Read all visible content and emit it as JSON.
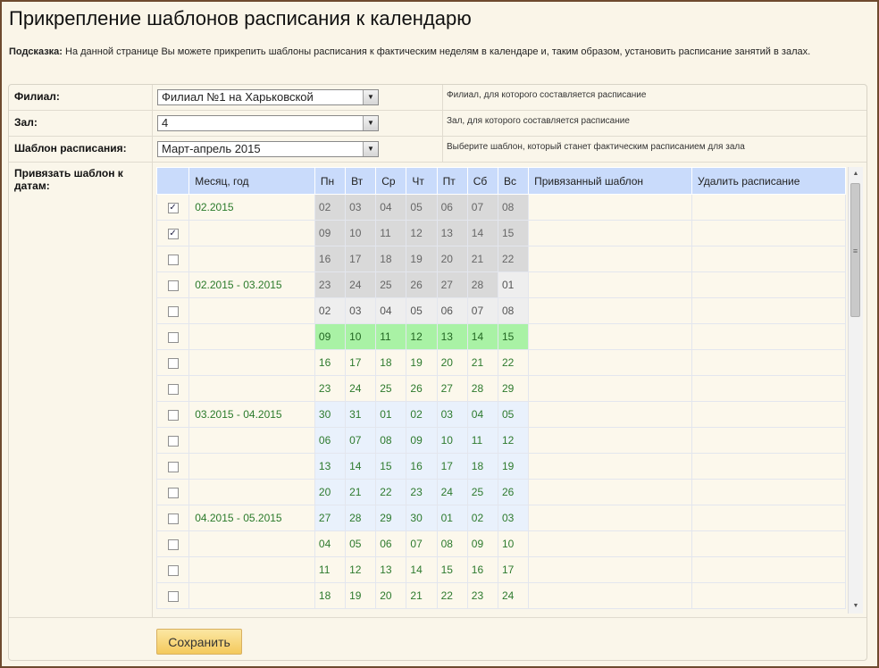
{
  "page": {
    "title": "Прикрепление шаблонов расписания к календарю",
    "hint_label": "Подсказка:",
    "hint_text": " На данной странице Вы можете прикрепить шаблоны расписания к фактическим неделям в календаре и, таким образом, установить расписание занятий в залах."
  },
  "form": {
    "branch": {
      "label": "Филиал:",
      "value": "Филиал №1 на Харьковской",
      "description": "Филиал, для которого составляется расписание"
    },
    "hall": {
      "label": "Зал:",
      "value": "4",
      "description": "Зал, для которого составляется расписание"
    },
    "template": {
      "label": "Шаблон расписания:",
      "value": "Март-апрель 2015",
      "description": "Выберите шаблон, который станет фактическим расписанием для зала"
    },
    "bind_label": "Привязать шаблон к датам:"
  },
  "grid": {
    "headers": [
      "",
      "Месяц, год",
      "Пн",
      "Вт",
      "Ср",
      "Чт",
      "Пт",
      "Сб",
      "Вс",
      "Привязанный шаблон",
      "Удалить расписание"
    ],
    "rows": [
      {
        "checked": true,
        "month": "02.2015",
        "days": [
          "02",
          "03",
          "04",
          "05",
          "06",
          "07",
          "08"
        ],
        "style": "past"
      },
      {
        "checked": true,
        "month": "",
        "days": [
          "09",
          "10",
          "11",
          "12",
          "13",
          "14",
          "15"
        ],
        "style": "past"
      },
      {
        "checked": false,
        "month": "",
        "days": [
          "16",
          "17",
          "18",
          "19",
          "20",
          "21",
          "22"
        ],
        "style": "past"
      },
      {
        "checked": false,
        "month": "02.2015 - 03.2015",
        "days": [
          "23",
          "24",
          "25",
          "26",
          "27",
          "28",
          "01"
        ],
        "style": "past-mixed"
      },
      {
        "checked": false,
        "month": "",
        "days": [
          "02",
          "03",
          "04",
          "05",
          "06",
          "07",
          "08"
        ],
        "style": "gray"
      },
      {
        "checked": false,
        "month": "",
        "days": [
          "09",
          "10",
          "11",
          "12",
          "13",
          "14",
          "15"
        ],
        "style": "current"
      },
      {
        "checked": false,
        "month": "",
        "days": [
          "16",
          "17",
          "18",
          "19",
          "20",
          "21",
          "22"
        ],
        "style": "plain"
      },
      {
        "checked": false,
        "month": "",
        "days": [
          "23",
          "24",
          "25",
          "26",
          "27",
          "28",
          "29"
        ],
        "style": "plain"
      },
      {
        "checked": false,
        "month": "03.2015 - 04.2015",
        "days": [
          "30",
          "31",
          "01",
          "02",
          "03",
          "04",
          "05"
        ],
        "style": "blue"
      },
      {
        "checked": false,
        "month": "",
        "days": [
          "06",
          "07",
          "08",
          "09",
          "10",
          "11",
          "12"
        ],
        "style": "blue"
      },
      {
        "checked": false,
        "month": "",
        "days": [
          "13",
          "14",
          "15",
          "16",
          "17",
          "18",
          "19"
        ],
        "style": "blue"
      },
      {
        "checked": false,
        "month": "",
        "days": [
          "20",
          "21",
          "22",
          "23",
          "24",
          "25",
          "26"
        ],
        "style": "blue"
      },
      {
        "checked": false,
        "month": "04.2015 - 05.2015",
        "days": [
          "27",
          "28",
          "29",
          "30",
          "01",
          "02",
          "03"
        ],
        "style": "blue"
      },
      {
        "checked": false,
        "month": "",
        "days": [
          "04",
          "05",
          "06",
          "07",
          "08",
          "09",
          "10"
        ],
        "style": "plain"
      },
      {
        "checked": false,
        "month": "",
        "days": [
          "11",
          "12",
          "13",
          "14",
          "15",
          "16",
          "17"
        ],
        "style": "plain"
      },
      {
        "checked": false,
        "month": "",
        "days": [
          "18",
          "19",
          "20",
          "21",
          "22",
          "23",
          "24"
        ],
        "style": "plain"
      }
    ]
  },
  "actions": {
    "save_label": "Сохранить"
  },
  "colors": {
    "past": "#d9d9d9",
    "gray": "#eeeeee",
    "current": "#a9f2a5",
    "header": "#c9dbfb",
    "month_text": "#2a7a2a"
  }
}
